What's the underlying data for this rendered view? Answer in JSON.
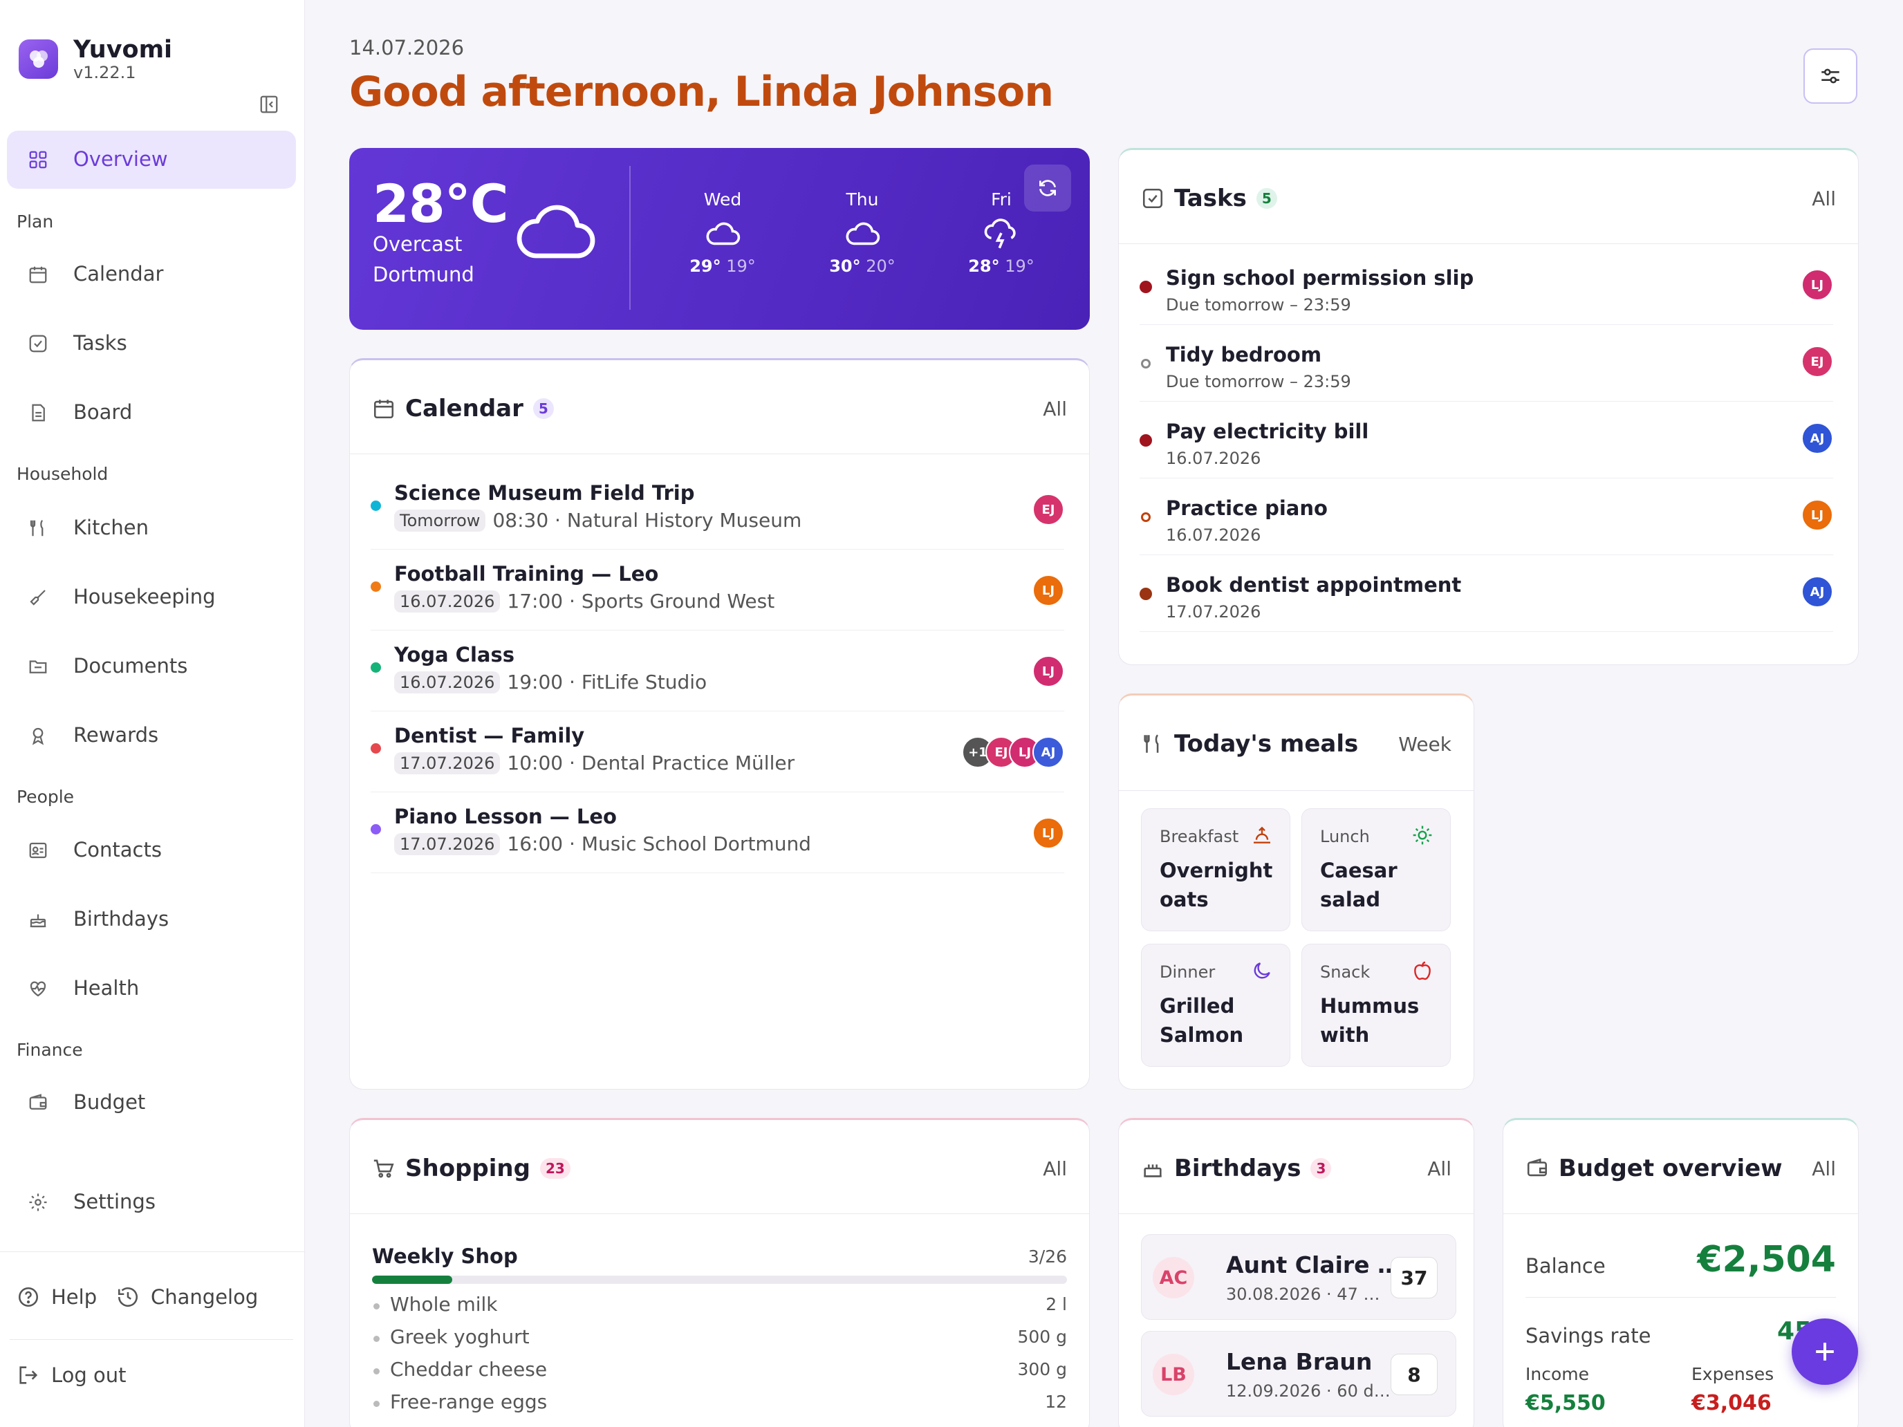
{
  "app": {
    "name": "Yuvomi",
    "version": "v1.22.1"
  },
  "sidebar": {
    "overview": "Overview",
    "sections": {
      "plan": "Plan",
      "household": "Household",
      "people": "People",
      "finance": "Finance"
    },
    "items": {
      "calendar": "Calendar",
      "tasks": "Tasks",
      "board": "Board",
      "kitchen": "Kitchen",
      "housekeeping": "Housekeeping",
      "documents": "Documents",
      "rewards": "Rewards",
      "contacts": "Contacts",
      "birthdays": "Birthdays",
      "health": "Health",
      "budget": "Budget",
      "settings": "Settings"
    },
    "help": "Help",
    "changelog": "Changelog",
    "logout": "Log out"
  },
  "header": {
    "date": "14.07.2026",
    "greeting": "Good afternoon, Linda Johnson"
  },
  "weather": {
    "temp": "28°C",
    "desc": "Overcast",
    "city": "Dortmund",
    "forecast": [
      {
        "day": "Wed",
        "high": "29°",
        "low": "19°",
        "icon": "cloud-icon"
      },
      {
        "day": "Thu",
        "high": "30°",
        "low": "20°",
        "icon": "cloud-icon"
      },
      {
        "day": "Fri",
        "high": "28°",
        "low": "19°",
        "icon": "thunder-cloud-icon"
      }
    ]
  },
  "calendar": {
    "title": "Calendar",
    "count": "5",
    "all": "All",
    "events": [
      {
        "title": "Science Museum Field Trip",
        "tag": "Tomorrow",
        "detail": "08:30 · Natural History Museum",
        "color": "#10b5d6",
        "avatars": [
          {
            "i": "EJ",
            "c": "#d6336c"
          }
        ]
      },
      {
        "title": "Football Training — Leo",
        "tag": "16.07.2026",
        "detail": "17:00 · Sports Ground West",
        "color": "#f07b16",
        "avatars": [
          {
            "i": "LJ",
            "c": "#ea6c0a"
          }
        ]
      },
      {
        "title": "Yoga Class",
        "tag": "16.07.2026",
        "detail": "19:00 · FitLife Studio",
        "color": "#16b378",
        "avatars": [
          {
            "i": "LJ",
            "c": "#d12c70"
          }
        ]
      },
      {
        "title": "Dentist — Family",
        "tag": "17.07.2026",
        "detail": "10:00 · Dental Practice Müller",
        "color": "#e5484d",
        "avatars": [
          {
            "i": "+1",
            "c": "#555555"
          },
          {
            "i": "EJ",
            "c": "#d6336c"
          },
          {
            "i": "LJ",
            "c": "#d12c70"
          },
          {
            "i": "AJ",
            "c": "#3b5bdb"
          }
        ]
      },
      {
        "title": "Piano Lesson — Leo",
        "tag": "17.07.2026",
        "detail": "16:00 · Music School Dortmund",
        "color": "#8b5cf6",
        "avatars": [
          {
            "i": "LJ",
            "c": "#ea6c0a"
          }
        ]
      }
    ]
  },
  "tasks": {
    "title": "Tasks",
    "count": "5",
    "all": "All",
    "items": [
      {
        "title": "Sign school permission slip",
        "due": "Due tomorrow – 23:59",
        "dot": "#a0141e",
        "ring": false,
        "avatar": "LJ",
        "ac": "#d12c70"
      },
      {
        "title": "Tidy bedroom",
        "due": "Due tomorrow – 23:59",
        "dot": "#888888",
        "ring": true,
        "avatar": "EJ",
        "ac": "#d6336c"
      },
      {
        "title": "Pay electricity bill",
        "due": "16.07.2026",
        "dot": "#a0141e",
        "ring": false,
        "avatar": "AJ",
        "ac": "#2f54d6"
      },
      {
        "title": "Practice piano",
        "due": "16.07.2026",
        "dot": "#c2410c",
        "ring": true,
        "avatar": "LJ",
        "ac": "#ea6c0a"
      },
      {
        "title": "Book dentist appointment",
        "due": "17.07.2026",
        "dot": "#9a3412",
        "ring": false,
        "avatar": "AJ",
        "ac": "#2f54d6"
      }
    ]
  },
  "meals": {
    "title": "Today's meals",
    "week": "Week",
    "items": [
      {
        "label": "Breakfast",
        "value": "Overnight oats",
        "icon": "sunrise-icon"
      },
      {
        "label": "Lunch",
        "value": "Caesar salad with…",
        "icon": "sun-icon"
      },
      {
        "label": "Dinner",
        "value": "Grilled Salmon &…",
        "icon": "moon-icon"
      },
      {
        "label": "Snack",
        "value": "Hummus with carro…",
        "icon": "apple-icon"
      }
    ]
  },
  "shopping": {
    "title": "Shopping",
    "count": "23",
    "all": "All",
    "list": "Weekly Shop",
    "progress_text": "3/26",
    "progress": 0.115,
    "items": [
      {
        "name": "Whole milk",
        "qty": "2 l"
      },
      {
        "name": "Greek yoghurt",
        "qty": "500 g"
      },
      {
        "name": "Cheddar cheese",
        "qty": "300 g"
      },
      {
        "name": "Free-range eggs",
        "qty": "12"
      }
    ]
  },
  "birthdays": {
    "title": "Birthdays",
    "count": "3",
    "all": "All",
    "items": [
      {
        "initials": "AC",
        "name": "Aunt Claire …",
        "date": "30.08.2026 · 47 …",
        "age": "37"
      },
      {
        "initials": "LB",
        "name": "Lena Braun",
        "date": "12.09.2026 · 60 d…",
        "age": "8"
      }
    ]
  },
  "budget": {
    "title": "Budget overview",
    "all": "All",
    "balance_label": "Balance",
    "balance": "€2,504",
    "savings_label": "Savings rate",
    "savings": "45",
    "income_label": "Income",
    "income": "€5,550",
    "expenses_label": "Expenses",
    "expenses": "€3,046"
  }
}
